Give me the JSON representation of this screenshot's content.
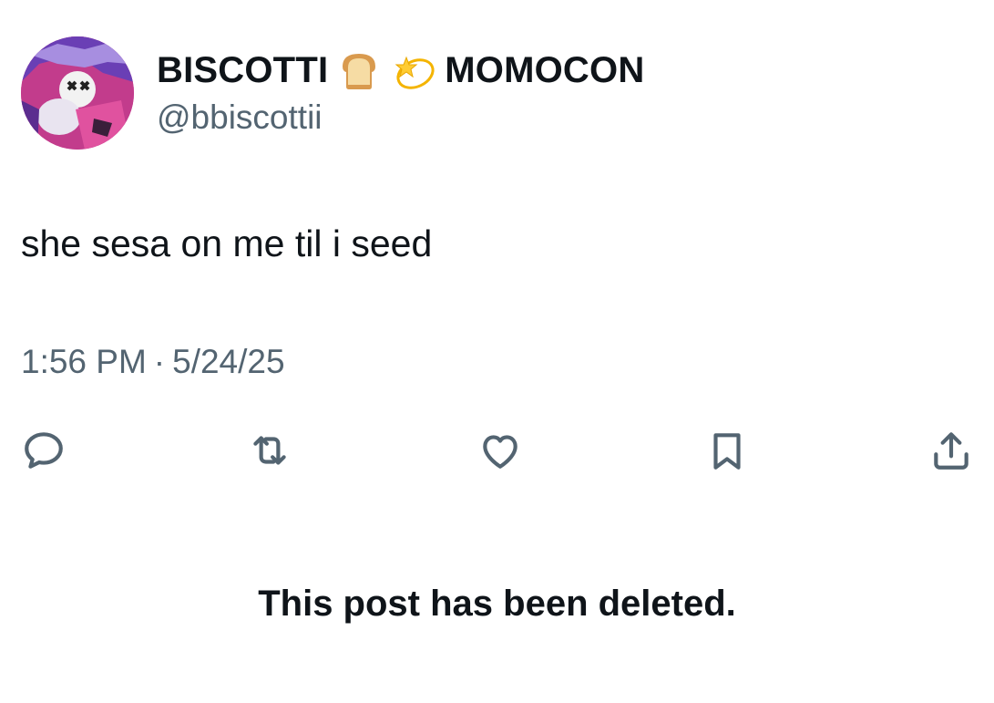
{
  "author": {
    "name_part1": "BISCOTTI",
    "name_part2": "MOMOCON",
    "emoji1": "bread-emoji",
    "emoji2": "dizzy-emoji",
    "handle": "@bbiscottii",
    "avatar": "avatar-image"
  },
  "post": {
    "text": "she sesa on me til i seed",
    "time": "1:56 PM",
    "separator": "·",
    "date": "5/24/25"
  },
  "actions": {
    "icons": [
      "reply-icon",
      "repost-icon",
      "like-icon",
      "bookmark-icon",
      "share-icon"
    ],
    "icon_color": "#536471"
  },
  "notice": {
    "deleted_text": "This post has been deleted."
  }
}
